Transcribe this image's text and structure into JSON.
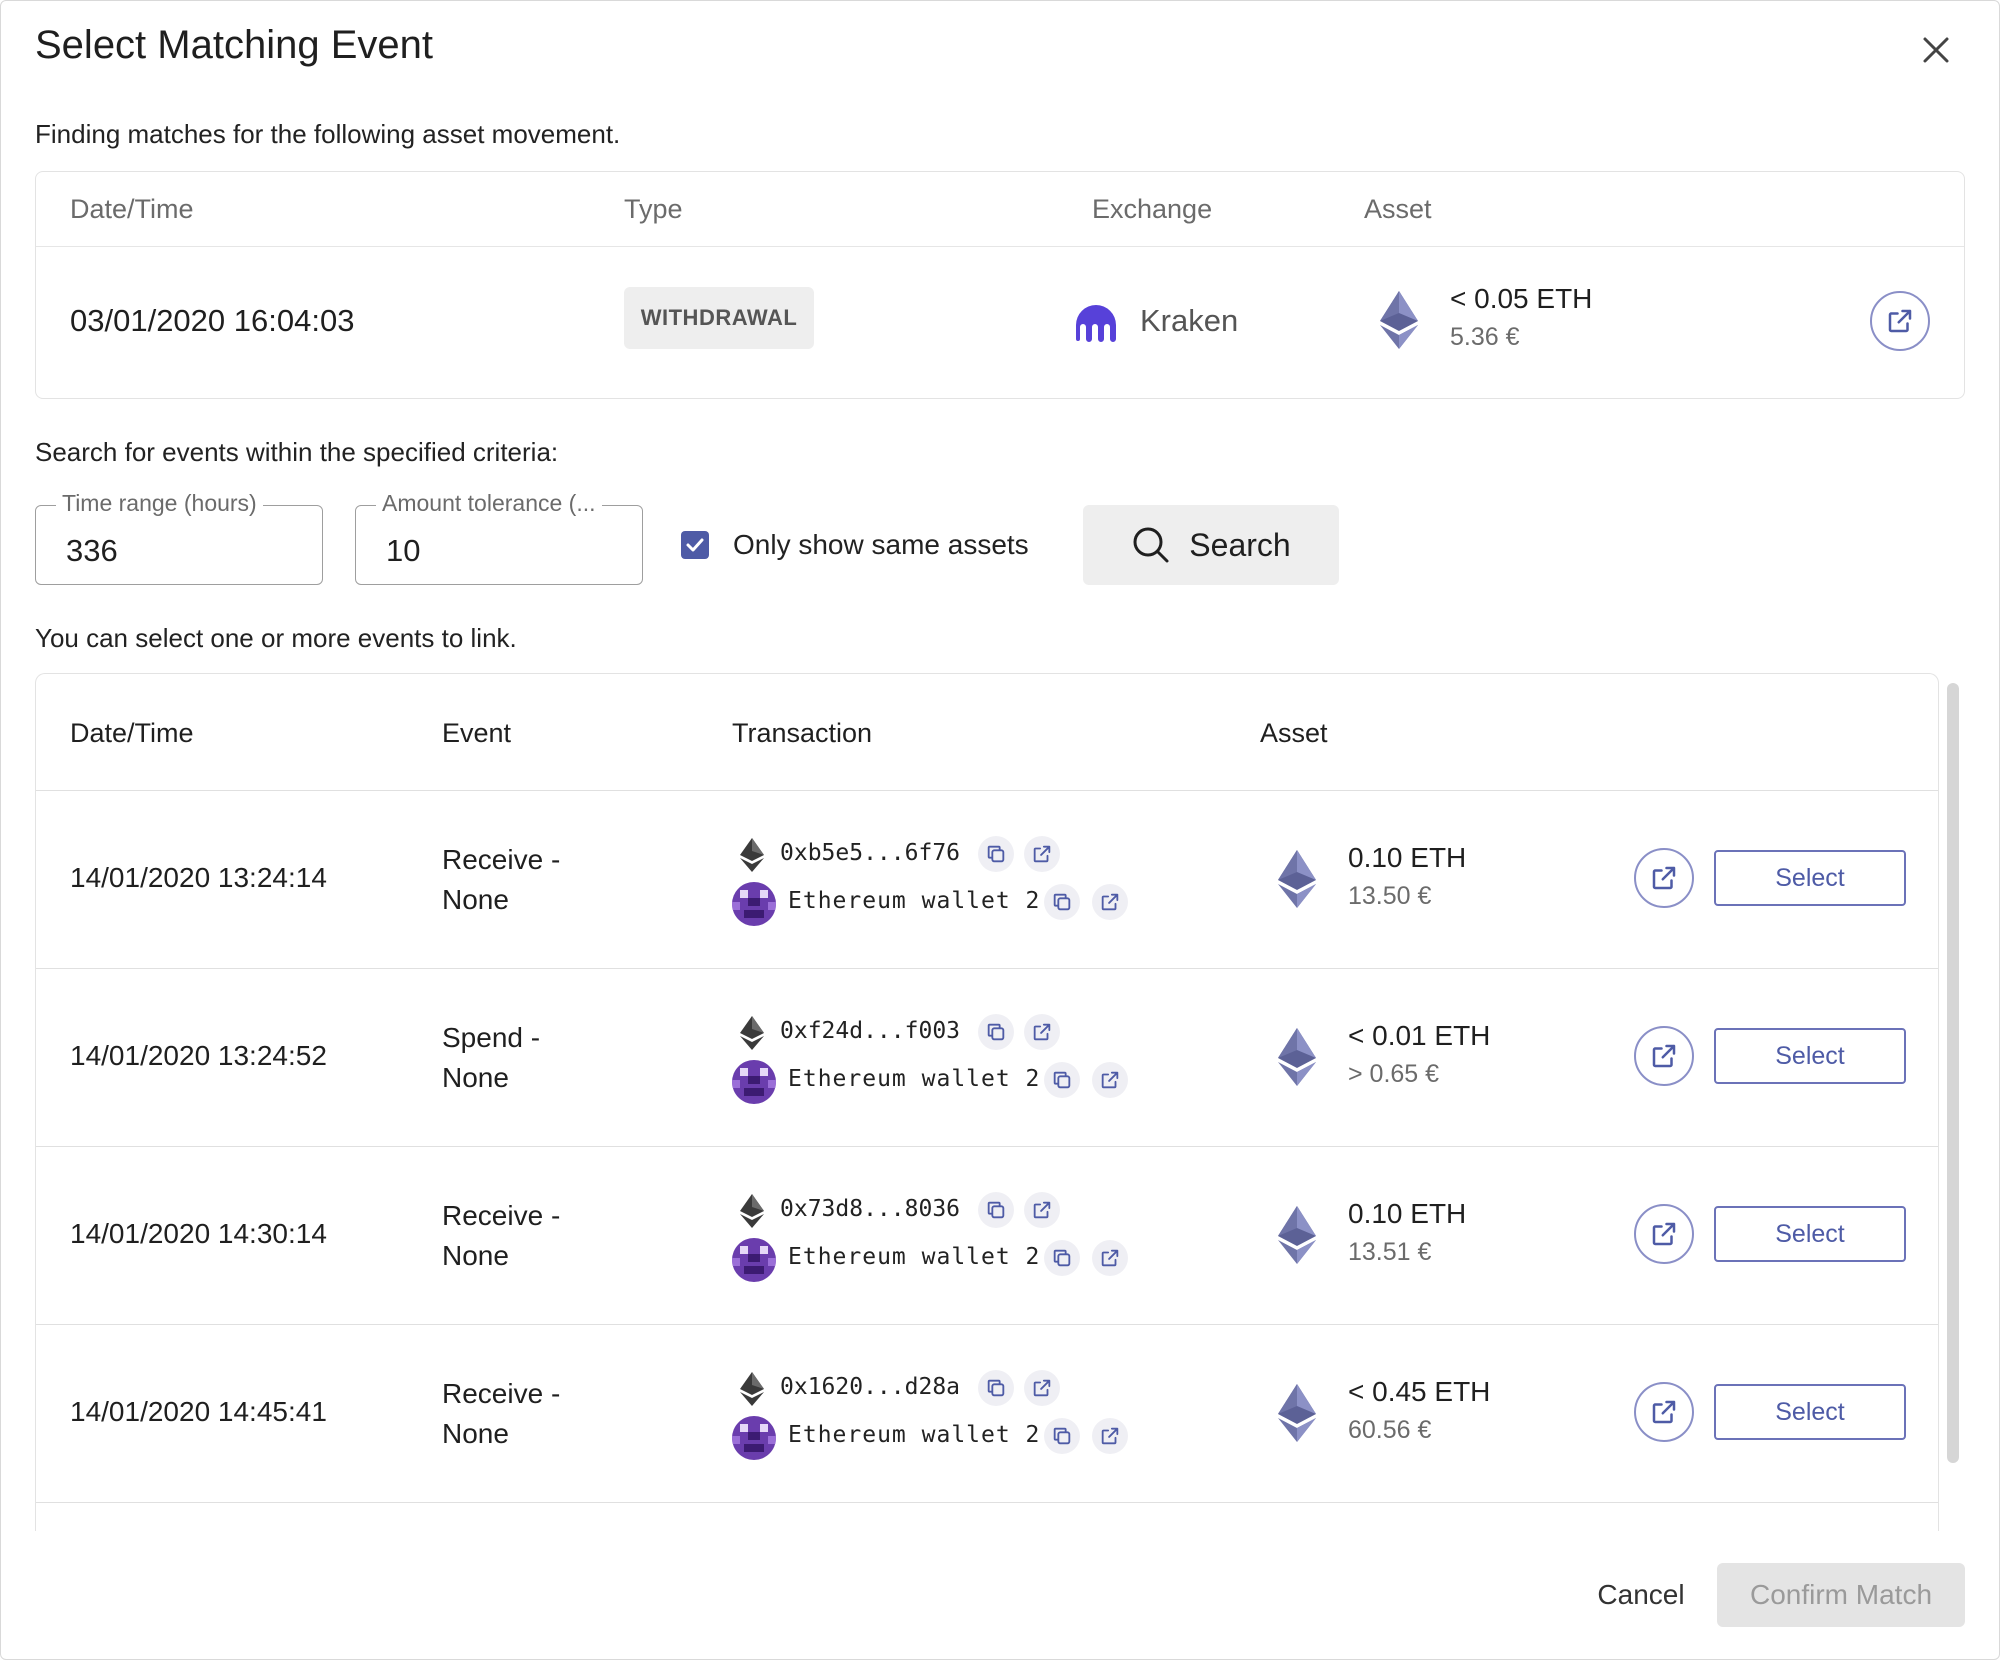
{
  "dialog": {
    "title": "Select Matching Event",
    "subtitle": "Finding matches for the following asset movement."
  },
  "movement": {
    "headers": {
      "datetime": "Date/Time",
      "type": "Type",
      "exchange": "Exchange",
      "asset": "Asset"
    },
    "datetime": "03/01/2020 16:04:03",
    "type": "WITHDRAWAL",
    "exchange": "Kraken",
    "amount": "< 0.05 ETH",
    "fiat": "5.36 €"
  },
  "search": {
    "label": "Search for events within the specified criteria:",
    "time_range_label": "Time range (hours)",
    "time_range_value": "336",
    "tolerance_label": "Amount tolerance (...",
    "tolerance_value": "10",
    "same_assets_label": "Only show same assets",
    "same_assets_checked": true,
    "search_label": "Search"
  },
  "results": {
    "hint": "You can select one or more events to link.",
    "headers": {
      "datetime": "Date/Time",
      "event": "Event",
      "transaction": "Transaction",
      "asset": "Asset"
    },
    "select_label": "Select",
    "rows": [
      {
        "datetime": "14/01/2020 13:24:14",
        "event": "Receive - None",
        "tx_hash": "0xb5e5...6f76",
        "wallet": "Ethereum wallet 2",
        "amount": "0.10 ETH",
        "fiat": "13.50 €"
      },
      {
        "datetime": "14/01/2020 13:24:52",
        "event": "Spend - None",
        "tx_hash": "0xf24d...f003",
        "wallet": "Ethereum wallet 2",
        "amount": "< 0.01 ETH",
        "fiat": "> 0.65 €"
      },
      {
        "datetime": "14/01/2020 14:30:14",
        "event": "Receive - None",
        "tx_hash": "0x73d8...8036",
        "wallet": "Ethereum wallet 2",
        "amount": "0.10 ETH",
        "fiat": "13.51 €"
      },
      {
        "datetime": "14/01/2020 14:45:41",
        "event": "Receive - None",
        "tx_hash": "0x1620...d28a",
        "wallet": "Ethereum wallet 2",
        "amount": "< 0.45 ETH",
        "fiat": "60.56 €"
      }
    ]
  },
  "footer": {
    "cancel_label": "Cancel",
    "confirm_label": "Confirm Match"
  },
  "colors": {
    "accent": "#4e5ba6",
    "kraken": "#5741d9",
    "avatar": "#6a3dad"
  },
  "icons": {
    "close": "close-icon",
    "eth": "ethereum-icon",
    "external": "external-link-icon",
    "copy": "copy-icon",
    "search": "search-icon",
    "check": "check-icon"
  }
}
